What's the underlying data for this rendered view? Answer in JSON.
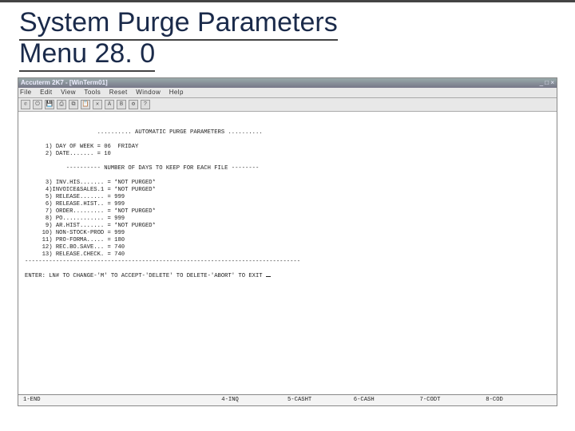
{
  "slide": {
    "title_line1": "System Purge Parameters",
    "title_line2": "Menu 28. 0"
  },
  "window": {
    "title": "Accuterm 2K7 - [WinTerm01]",
    "menubar": [
      "File",
      "Edit",
      "View",
      "Tools",
      "Reset",
      "Window",
      "Help"
    ],
    "toolbar_icons": [
      "connect-icon",
      "disconnect-icon",
      "save-icon",
      "print-icon",
      "copy-icon",
      "paste-icon",
      "clear-icon",
      "a-icon",
      "b-icon",
      "settings-icon",
      "help-icon"
    ]
  },
  "terminal": {
    "banner": ".......... AUTOMATIC PURGE PARAMETERS ..........",
    "lines_top": [
      "1) DAY OF WEEK = 06  FRIDAY",
      "2) DATE....... = 10"
    ],
    "subheader": "---------- NUMBER OF DAYS TO KEEP FOR EACH FILE --------",
    "params": [
      "3) INV.HIS....... = *NOT PURGED*",
      "4)INVOICE&SALES.1 = *NOT PURGED*",
      "5) RELEASE....... = 999",
      "6) RELEASE.HIST.. = 999",
      "7) ORDER......... = *NOT PURGED*",
      "8) PO............ = 999",
      "9) AR.HIST....... = *NOT PURGED*",
      "10) NON-STOCK-PROD = 999",
      "11) PRO-FORMA..... = 180",
      "12) REC.BO.SAVE... = 740",
      "13) RELEASE.CHECK. = 740"
    ],
    "divider": "--------------------------------------------------------------------------------",
    "prompt": "ENTER: LN# TO CHANGE-'M' TO ACCEPT-'DELETE' TO DELETE-'ABORT' TO EXIT "
  },
  "fkeys": {
    "f1": "1-END",
    "f4": "4-INQ",
    "f5": "5-CASHT",
    "f6": "6-CASH",
    "f7": "7-CODT",
    "f8": "8-COD"
  }
}
